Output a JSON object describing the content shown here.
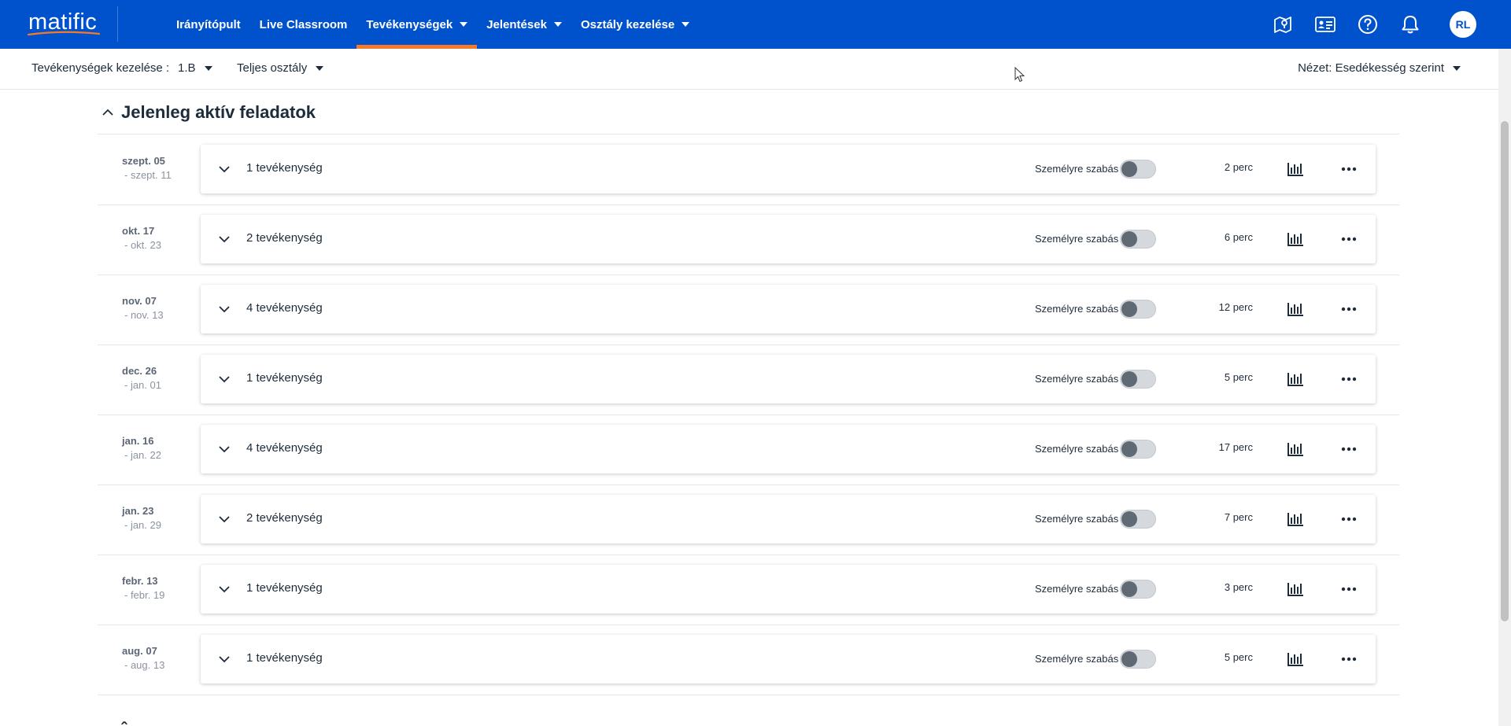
{
  "nav": {
    "logo_text": "matific",
    "items": [
      {
        "label": "Irányítópult",
        "dropdown": false,
        "active": false
      },
      {
        "label": "Live Classroom",
        "dropdown": false,
        "active": false
      },
      {
        "label": "Tevékenységek",
        "dropdown": true,
        "active": true
      },
      {
        "label": "Jelentések",
        "dropdown": true,
        "active": false
      },
      {
        "label": "Osztály kezelése",
        "dropdown": true,
        "active": false
      }
    ],
    "icons": [
      "map-icon",
      "id-card-icon",
      "help-icon",
      "bell-icon"
    ],
    "avatar_initials": "RL",
    "colors": {
      "bar": "#0052cc",
      "active_underline": "#f47a2a"
    }
  },
  "subheader": {
    "label": "Tevékenységek kezelése :",
    "class_value": "1.B",
    "group_value": "Teljes osztály",
    "view_value": "Nézet: Esedékesség szerint"
  },
  "section": {
    "title": "Jelenleg aktív feladatok"
  },
  "personalize_label": "Személyre szabás",
  "rows": [
    {
      "start": "szept. 05",
      "end": "- szept. 11",
      "count": "1 tevékenység",
      "time": "2 perc"
    },
    {
      "start": "okt. 17",
      "end": "- okt. 23",
      "count": "2 tevékenység",
      "time": "6 perc"
    },
    {
      "start": "nov. 07",
      "end": "- nov. 13",
      "count": "4 tevékenység",
      "time": "12 perc"
    },
    {
      "start": "dec. 26",
      "end": "- jan. 01",
      "count": "1 tevékenység",
      "time": "5 perc"
    },
    {
      "start": "jan. 16",
      "end": "- jan. 22",
      "count": "4 tevékenység",
      "time": "17 perc"
    },
    {
      "start": "jan. 23",
      "end": "- jan. 29",
      "count": "2 tevékenység",
      "time": "7 perc"
    },
    {
      "start": "febr. 13",
      "end": "- febr. 19",
      "count": "1 tevékenység",
      "time": "3 perc"
    },
    {
      "start": "aug. 07",
      "end": "- aug. 13",
      "count": "1 tevékenység",
      "time": "5 perc"
    }
  ]
}
